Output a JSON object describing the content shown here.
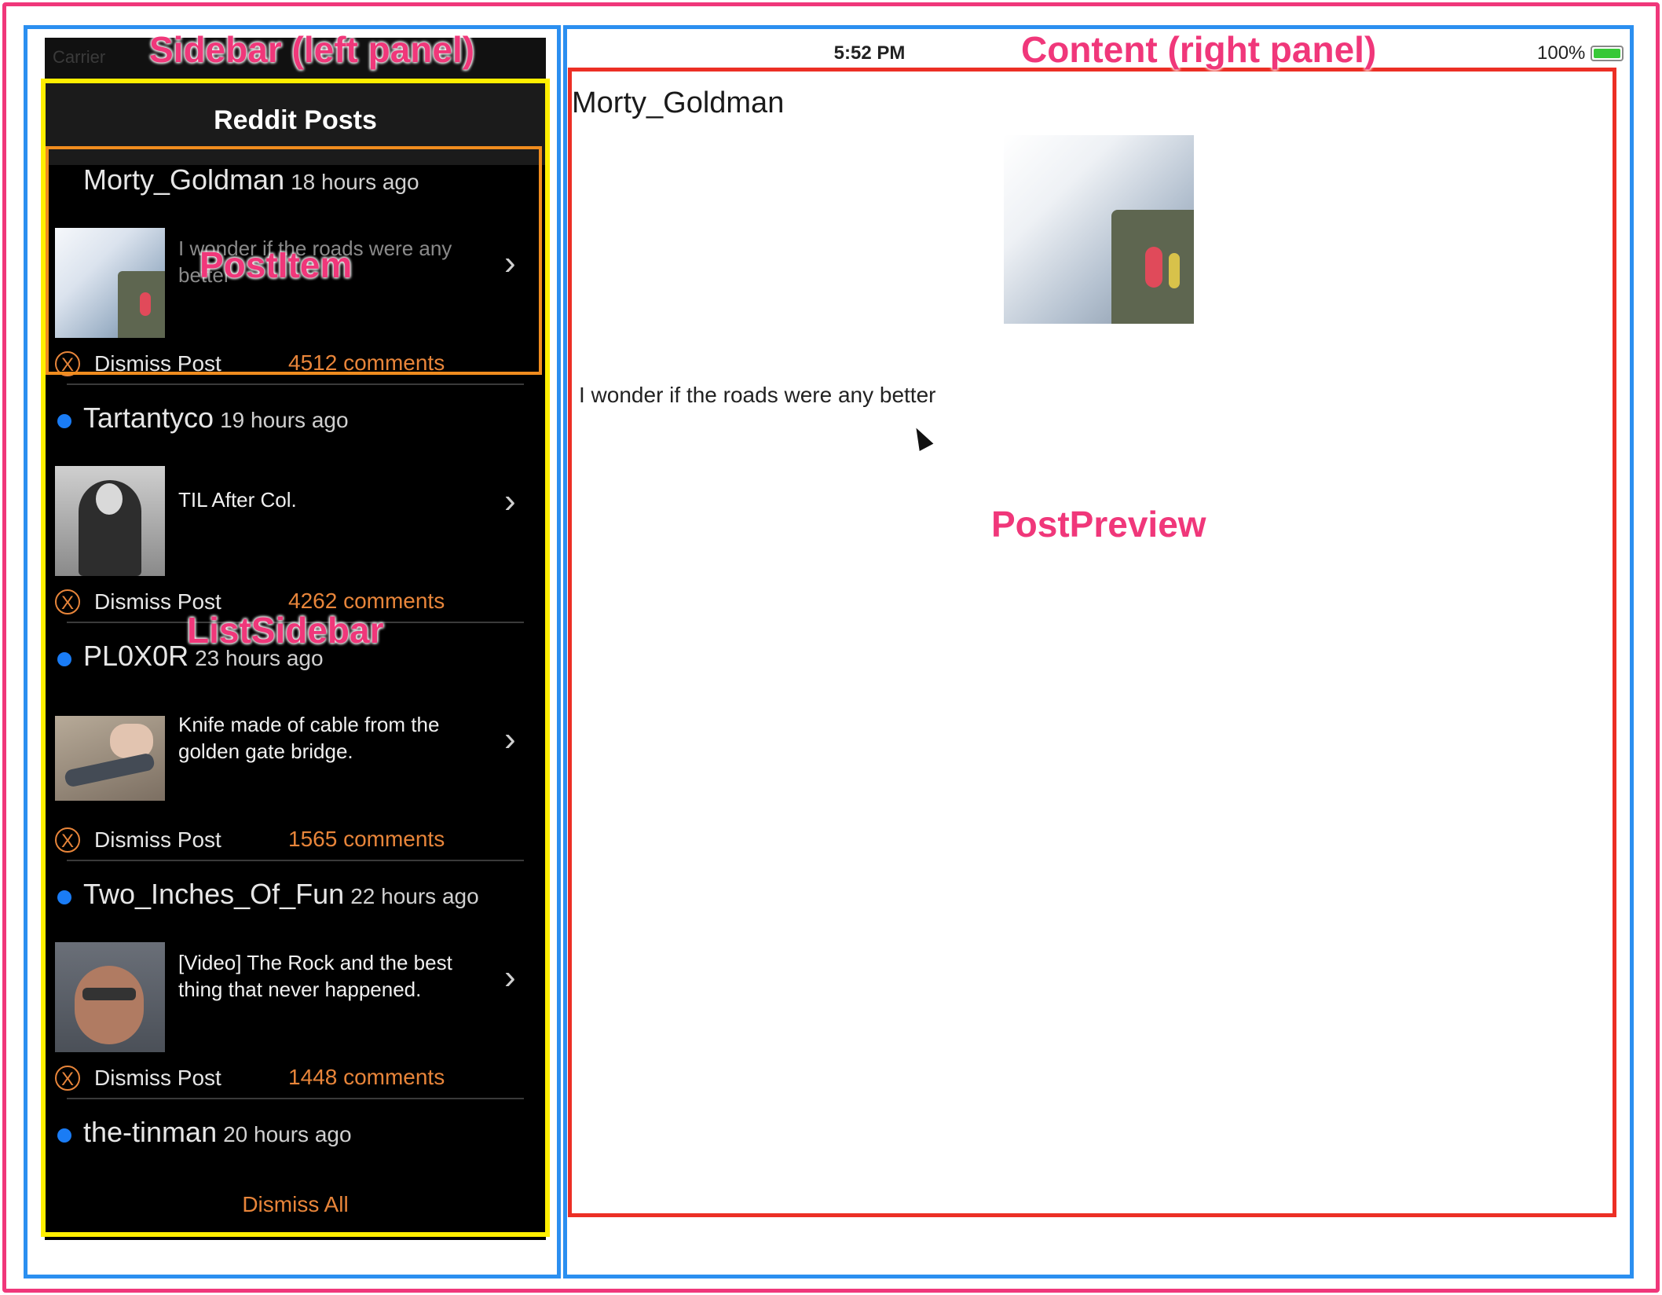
{
  "annotations": {
    "sidebar": "Sidebar (left panel)",
    "content": "Content (right panel)",
    "post_item": "PostItem",
    "list_sidebar": "ListSidebar",
    "post_preview": "PostPreview"
  },
  "status_bar": {
    "carrier": "Carrier",
    "time": "5:52 PM",
    "battery": "100%"
  },
  "sidebar": {
    "title": "Reddit Posts",
    "dismiss_all": "Dismiss All",
    "dismiss_label": "Dismiss Post",
    "posts": [
      {
        "author": "Morty_Goldman",
        "time": "18 hours ago",
        "title": "I wonder if the roads were any better",
        "comments": "4512 comments",
        "unread": false
      },
      {
        "author": "Tartantyco",
        "time": "19 hours ago",
        "title": "TIL After Col.",
        "comments": "4262 comments",
        "unread": true
      },
      {
        "author": "PL0X0R",
        "time": "23 hours ago",
        "title": "Knife made of cable from the golden gate bridge.",
        "comments": "1565 comments",
        "unread": true
      },
      {
        "author": "Two_Inches_Of_Fun",
        "time": "22 hours ago",
        "title": "[Video] The Rock and the best thing that never happened.",
        "comments": "1448 comments",
        "unread": true
      },
      {
        "author": "the-tinman",
        "time": "20 hours ago",
        "title": "",
        "comments": "",
        "unread": true
      }
    ]
  },
  "preview": {
    "author": "Morty_Goldman",
    "text": "I wonder if the roads were any better"
  },
  "colors": {
    "accent": "#e8853a",
    "unread_dot": "#1a7cf5",
    "annotation": "#f0377a",
    "panel_border": "#2b8ff0",
    "list_border": "#ffee00",
    "item_border": "#f08c1e",
    "preview_border": "#ec2f25"
  }
}
